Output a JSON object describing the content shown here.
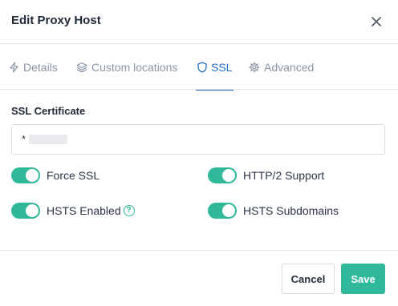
{
  "modal": {
    "title": "Edit Proxy Host",
    "close_icon": "close-icon"
  },
  "tabs": [
    {
      "label": "Details",
      "icon": "bolt-icon",
      "active": false
    },
    {
      "label": "Custom locations",
      "icon": "layers-icon",
      "active": false
    },
    {
      "label": "SSL",
      "icon": "shield-icon",
      "active": true
    },
    {
      "label": "Advanced",
      "icon": "gear-icon",
      "active": false
    }
  ],
  "ssl": {
    "certificate_label": "SSL Certificate",
    "certificate_value": "*",
    "toggles": [
      {
        "label": "Force SSL",
        "on": true
      },
      {
        "label": "HTTP/2 Support",
        "on": true
      },
      {
        "label": "HSTS Enabled",
        "on": true,
        "help": "?"
      },
      {
        "label": "HSTS Subdomains",
        "on": true
      }
    ]
  },
  "footer": {
    "cancel_label": "Cancel",
    "save_label": "Save"
  },
  "colors": {
    "accent": "#2fb99a",
    "tab_active": "#206bc4",
    "tab_inactive": "#8a94a4"
  }
}
